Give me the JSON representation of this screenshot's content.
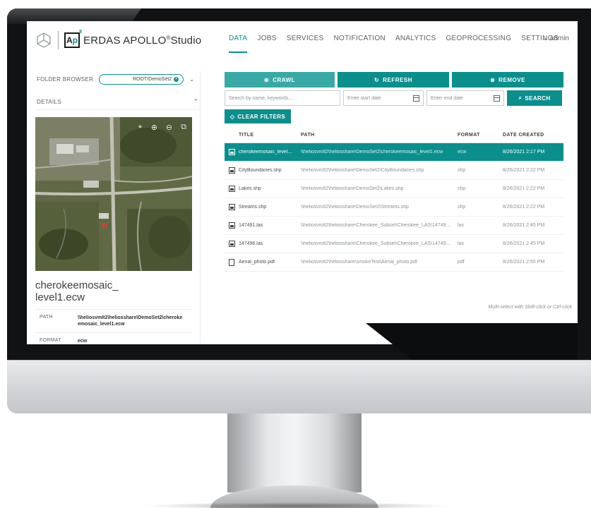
{
  "app": {
    "brand_name": "ERDAS APOLLO",
    "brand_reg": "®",
    "brand_suffix": "Studio",
    "badge_letters": "A",
    "badge_accent": "p",
    "badge_sup": "9"
  },
  "nav": {
    "items": [
      "DATA",
      "JOBS",
      "SERVICES",
      "NOTIFICATION",
      "ANALYTICS",
      "GEOPROCESSING",
      "SETTINGS"
    ],
    "active": "DATA",
    "user": "⌄ admin"
  },
  "folder_browser": {
    "label": "FOLDER BROWSER",
    "selected_folder": "ROOT/DemoSet2"
  },
  "details": {
    "label": "DETAILS",
    "file_title": "cherokeemosaic_ level1.ecw",
    "fields": [
      {
        "key": "PATH",
        "value": "\\\\heliosvmlt2\\heliosshare\\DemoSet2\\cherokeemosaic_level1.ecw"
      },
      {
        "key": "FORMAT",
        "value": "ecw"
      }
    ]
  },
  "actions": {
    "crawl": "CRAWL",
    "refresh": "REFRESH",
    "remove": "REMOVE",
    "search": "SEARCH",
    "clear_filters": "CLEAR FILTERS"
  },
  "search": {
    "keyword_placeholder": "Search by name, keywords,...",
    "start_date_placeholder": "Enter start date",
    "end_date_placeholder": "Enter end date"
  },
  "table": {
    "headers": {
      "title": "TITLE",
      "path": "PATH",
      "format": "FORMAT",
      "date": "DATE CREATED"
    },
    "rows": [
      {
        "title": "cherokeemosaic_level...",
        "path": "\\\\heliosvmlt2\\heliosshare\\DemoSet2\\cherokeemosaic_level1.ecw",
        "format": "ecw",
        "date": "8/26/2021 2:17 PM",
        "icon": "image-file-icon",
        "selected": true
      },
      {
        "title": "CityBoundaries.shp",
        "path": "\\\\heliosvmlt2\\heliosshare\\DemoSet2\\CityBoundaries.shp",
        "format": "shp",
        "date": "8/26/2021 2:22 PM",
        "icon": "image-file-icon",
        "selected": false
      },
      {
        "title": "Lakes.shp",
        "path": "\\\\heliosvmlt2\\heliosshare\\DemoSet2\\Lakes.shp",
        "format": "shp",
        "date": "8/26/2021 2:22 PM",
        "icon": "image-file-icon",
        "selected": false
      },
      {
        "title": "Streams.shp",
        "path": "\\\\heliosvmlt2\\heliosshare\\DemoSet2\\Streams.shp",
        "format": "shp",
        "date": "8/26/2021 2:22 PM",
        "icon": "image-file-icon",
        "selected": false
      },
      {
        "title": "147491.las",
        "path": "\\\\heliosvmlt2\\heliosshare\\Cherokee_Subset\\Cherokee_LAS\\14749...",
        "format": "las",
        "date": "8/26/2021 2:45 PM",
        "icon": "image-file-icon",
        "selected": false
      },
      {
        "title": "147496.las",
        "path": "\\\\heliosvmlt2\\heliosshare\\Cherokee_Subset\\Cherokee_LAS\\14749...",
        "format": "las",
        "date": "8/26/2021 2:45 PM",
        "icon": "image-file-icon",
        "selected": false
      },
      {
        "title": "Aerial_photo.pdf",
        "path": "\\\\heliosvmlt2\\heliosshare\\smokeTest\\Aerial_photo.pdf",
        "format": "pdf",
        "date": "8/26/2021 2:55 PM",
        "icon": "document-file-icon",
        "selected": false
      }
    ]
  },
  "hint": "Multi-select with Shift-click or Ctrl-click",
  "colors": {
    "accent": "#0a8f8d",
    "accent_light": "#39a9a6",
    "bezel": "#101214"
  }
}
